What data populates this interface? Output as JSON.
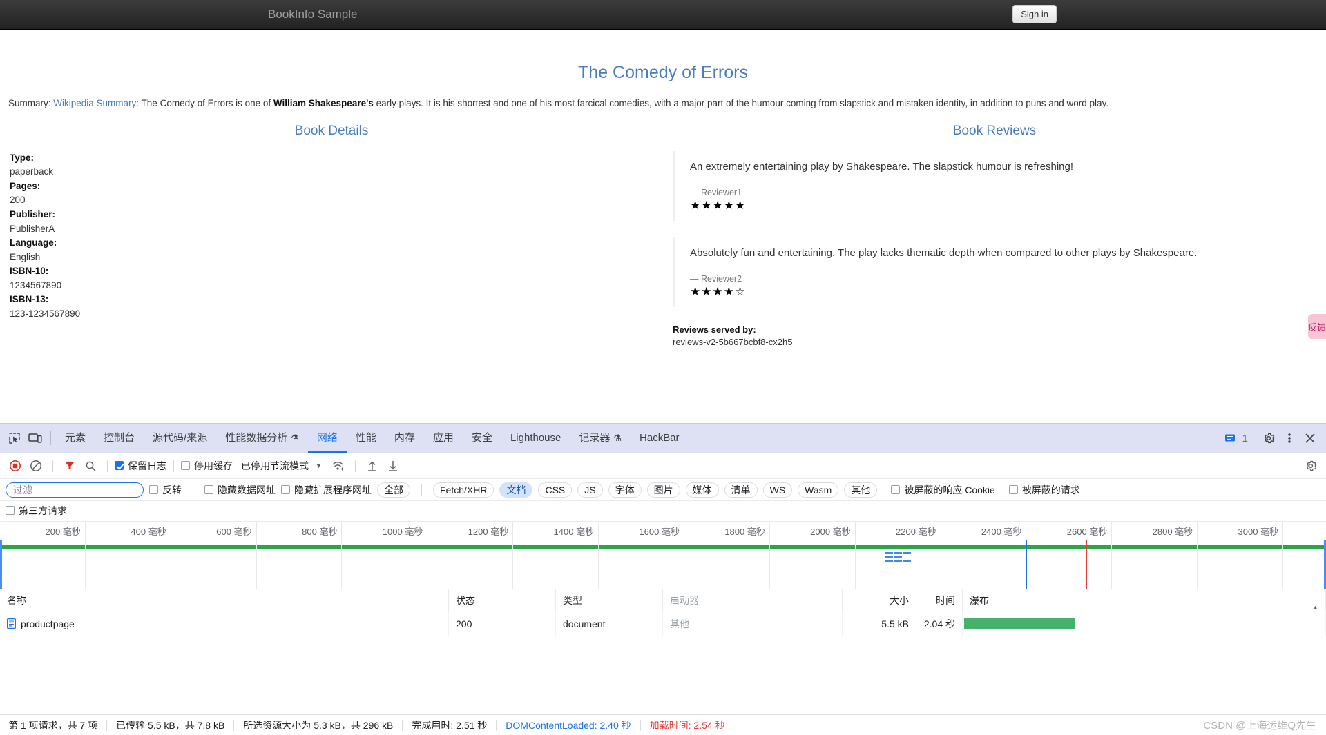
{
  "navbar": {
    "brand": "BookInfo Sample",
    "signin": "Sign in"
  },
  "book": {
    "title": "The Comedy of Errors",
    "summary_prefix": "Summary: ",
    "summary_link": "Wikipedia Summary",
    "summary_mid": ": The Comedy of Errors is one of ",
    "summary_bold": "William Shakespeare's",
    "summary_rest": " early plays. It is his shortest and one of his most farcical comedies, with a major part of the humour coming from slapstick and mistaken identity, in addition to puns and word play."
  },
  "details": {
    "heading": "Book Details",
    "rows": [
      {
        "label": "Type:",
        "value": "paperback"
      },
      {
        "label": "Pages:",
        "value": "200"
      },
      {
        "label": "Publisher:",
        "value": "PublisherA"
      },
      {
        "label": "Language:",
        "value": "English"
      },
      {
        "label": "ISBN-10:",
        "value": "1234567890"
      },
      {
        "label": "ISBN-13:",
        "value": "123-1234567890"
      }
    ]
  },
  "reviews": {
    "heading": "Book Reviews",
    "items": [
      {
        "text": "An extremely entertaining play by Shakespeare. The slapstick humour is refreshing!",
        "author": "— Reviewer1",
        "stars": "★★★★★",
        "rating": 5
      },
      {
        "text": "Absolutely fun and entertaining. The play lacks thematic depth when compared to other plays by Shakespeare.",
        "author": "— Reviewer2",
        "stars": "★★★★☆",
        "rating": 4
      }
    ],
    "served_by_label": "Reviews served by:",
    "served_by_value": "reviews-v2-5b667bcbf8-cx2h5"
  },
  "feedback_tab": "反馈",
  "devtools": {
    "tabs": [
      {
        "label": "元素",
        "active": false,
        "flask": false
      },
      {
        "label": "控制台",
        "active": false,
        "flask": false
      },
      {
        "label": "源代码/来源",
        "active": false,
        "flask": false
      },
      {
        "label": "性能数据分析",
        "active": false,
        "flask": true
      },
      {
        "label": "网络",
        "active": true,
        "flask": false
      },
      {
        "label": "性能",
        "active": false,
        "flask": false
      },
      {
        "label": "内存",
        "active": false,
        "flask": false
      },
      {
        "label": "应用",
        "active": false,
        "flask": false
      },
      {
        "label": "安全",
        "active": false,
        "flask": false
      },
      {
        "label": "Lighthouse",
        "active": false,
        "flask": false
      },
      {
        "label": "记录器",
        "active": false,
        "flask": true
      },
      {
        "label": "HackBar",
        "active": false,
        "flask": false
      }
    ],
    "issues_count": "1",
    "toolbar": {
      "preserve_log": "保留日志",
      "preserve_log_checked": true,
      "disable_cache": "停用缓存",
      "disable_cache_checked": false,
      "throttling": "已停用节流模式"
    },
    "filterbar": {
      "filter_placeholder": "过滤",
      "filter_value": "",
      "invert": "反转",
      "hide_data_urls": "隐藏数据网址",
      "hide_ext_urls": "隐藏扩展程序网址",
      "types": [
        "全部",
        "Fetch/XHR",
        "文档",
        "CSS",
        "JS",
        "字体",
        "图片",
        "媒体",
        "清单",
        "WS",
        "Wasm",
        "其他"
      ],
      "active_type": "文档",
      "blocked_cookies": "被屏蔽的响应 Cookie",
      "blocked_requests": "被屏蔽的请求",
      "third_party": "第三方请求"
    },
    "overview": {
      "ticks": [
        "200 毫秒",
        "400 毫秒",
        "600 毫秒",
        "800 毫秒",
        "1000 毫秒",
        "1200 毫秒",
        "1400 毫秒",
        "1600 毫秒",
        "1800 毫秒",
        "2000 毫秒",
        "2200 毫秒",
        "2400 毫秒",
        "2600 毫秒",
        "2800 毫秒",
        "3000 毫秒"
      ],
      "dcl_ms": 2400,
      "load_ms": 2540,
      "max_ms": 3100
    },
    "table": {
      "headers": [
        "名称",
        "状态",
        "类型",
        "启动器",
        "大小",
        "时间",
        "瀑布"
      ],
      "rows": [
        {
          "name": "productpage",
          "status": "200",
          "type": "document",
          "initiator": "其他",
          "size": "5.5 kB",
          "time": "2.04 秒"
        }
      ]
    },
    "status": {
      "requests": "第 1 项请求，共 7 项",
      "transferred": "已传输 5.5 kB，共 7.8 kB",
      "resources": "所选资源大小为 5.3 kB，共 296 kB",
      "finish": "完成用时: 2.51 秒",
      "dcl": "DOMContentLoaded: 2.40 秒",
      "load": "加载时间: 2.54 秒"
    },
    "watermark": "CSDN @上海运维Q先生"
  }
}
